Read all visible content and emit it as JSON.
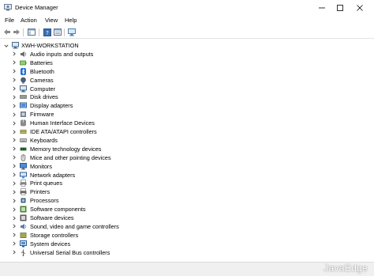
{
  "window": {
    "title": "Device Manager"
  },
  "menu": [
    "File",
    "Action",
    "View",
    "Help"
  ],
  "tree": {
    "root": "XWH-WORKSTATION",
    "categories": [
      {
        "label": "Audio inputs and outputs",
        "icon": "speaker-icon"
      },
      {
        "label": "Batteries",
        "icon": "battery-icon"
      },
      {
        "label": "Bluetooth",
        "icon": "bluetooth-icon"
      },
      {
        "label": "Cameras",
        "icon": "camera-icon"
      },
      {
        "label": "Computer",
        "icon": "computer-icon"
      },
      {
        "label": "Disk drives",
        "icon": "disk-drive-icon"
      },
      {
        "label": "Display adapters",
        "icon": "display-adapter-icon"
      },
      {
        "label": "Firmware",
        "icon": "firmware-icon"
      },
      {
        "label": "Human Interface Devices",
        "icon": "hid-icon"
      },
      {
        "label": "IDE ATA/ATAPI controllers",
        "icon": "ide-controller-icon"
      },
      {
        "label": "Keyboards",
        "icon": "keyboard-icon"
      },
      {
        "label": "Memory technology devices",
        "icon": "memory-icon"
      },
      {
        "label": "Mice and other pointing devices",
        "icon": "mouse-icon"
      },
      {
        "label": "Monitors",
        "icon": "monitor-icon"
      },
      {
        "label": "Network adapters",
        "icon": "network-adapter-icon"
      },
      {
        "label": "Print queues",
        "icon": "print-queue-icon"
      },
      {
        "label": "Printers",
        "icon": "printer-icon"
      },
      {
        "label": "Processors",
        "icon": "processor-icon"
      },
      {
        "label": "Software components",
        "icon": "software-component-icon"
      },
      {
        "label": "Software devices",
        "icon": "software-device-icon"
      },
      {
        "label": "Sound, video and game controllers",
        "icon": "sound-controller-icon"
      },
      {
        "label": "Storage controllers",
        "icon": "storage-controller-icon"
      },
      {
        "label": "System devices",
        "icon": "system-device-icon"
      },
      {
        "label": "Universal Serial Bus controllers",
        "icon": "usb-icon"
      }
    ]
  },
  "watermark": "JavaEdge",
  "colors": {
    "accent": "#1e6fd9",
    "toolbar_icon": "#4a7fb5"
  }
}
